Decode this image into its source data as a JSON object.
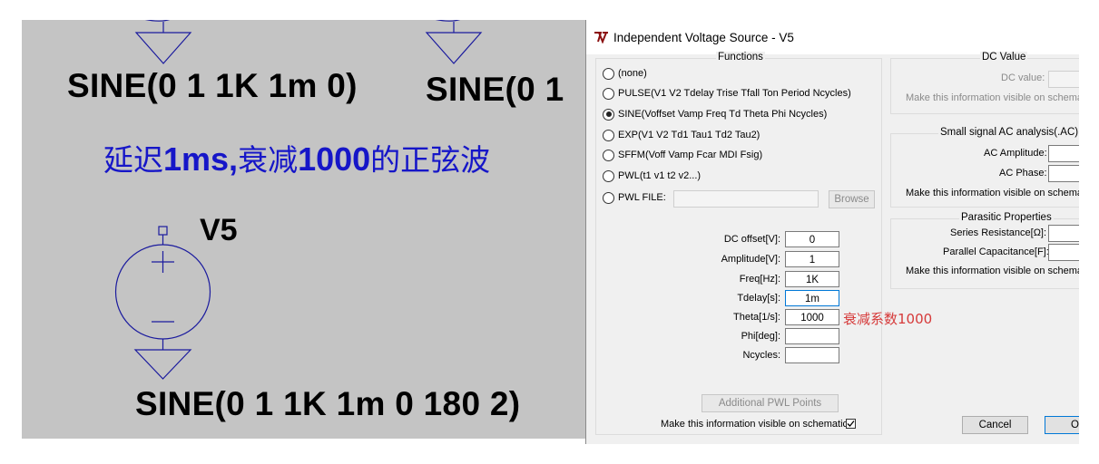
{
  "schematic": {
    "sine_top_left": "SINE(0 1 1K 1m 0)",
    "sine_top_right": "SINE(0 1",
    "chinese_prefix": "延迟",
    "chinese_delay": "1ms,",
    "chinese_mid": "衰减",
    "chinese_value": "1000",
    "chinese_suffix": "的正弦波",
    "source_name": "V5",
    "sine_bottom": "SINE(0 1 1K 1m 0 180 2)",
    "wire_color": "#1b1b9e",
    "label_color": "#1616c8"
  },
  "dialog": {
    "title": "Independent Voltage Source - V5",
    "functions": {
      "title": "Functions",
      "options": [
        {
          "label": "(none)",
          "selected": false
        },
        {
          "label": "PULSE(V1 V2 Tdelay Trise Tfall Ton Period Ncycles)",
          "selected": false
        },
        {
          "label": "SINE(Voffset Vamp Freq Td Theta Phi Ncycles)",
          "selected": true
        },
        {
          "label": "EXP(V1 V2 Td1 Tau1 Td2 Tau2)",
          "selected": false
        },
        {
          "label": "SFFM(Voff Vamp Fcar MDI Fsig)",
          "selected": false
        },
        {
          "label": "PWL(t1 v1 t2 v2...)",
          "selected": false
        },
        {
          "label": "PWL FILE:",
          "selected": false
        }
      ],
      "browse": "Browse",
      "params": [
        {
          "label": "DC offset[V]:",
          "value": "0"
        },
        {
          "label": "Amplitude[V]:",
          "value": "1"
        },
        {
          "label": "Freq[Hz]:",
          "value": "1K"
        },
        {
          "label": "Tdelay[s]:",
          "value": "1m"
        },
        {
          "label": "Theta[1/s]:",
          "value": "1000"
        },
        {
          "label": "Phi[deg]:",
          "value": ""
        },
        {
          "label": "Ncycles:",
          "value": ""
        }
      ],
      "additional_pwl": "Additional PWL Points",
      "visible_label": "Make this information visible on schematic:",
      "visible_checked": true
    },
    "dc_value": {
      "title": "DC Value",
      "label": "DC value:",
      "visible_label": "Make this information visible on schemat"
    },
    "ac": {
      "title": "Small signal AC analysis(.AC)",
      "amplitude_label": "AC Amplitude:",
      "phase_label": "AC Phase:",
      "visible_label": "Make this information visible on schemat"
    },
    "parasitic": {
      "title": "Parasitic Properties",
      "series_label": "Series Resistance[Ω]:",
      "parallel_label": "Parallel Capacitance[F]:",
      "visible_label": "Make this information visible on schemat"
    },
    "cancel": "Cancel",
    "ok": "O"
  },
  "annotation": "衰减系数1000"
}
